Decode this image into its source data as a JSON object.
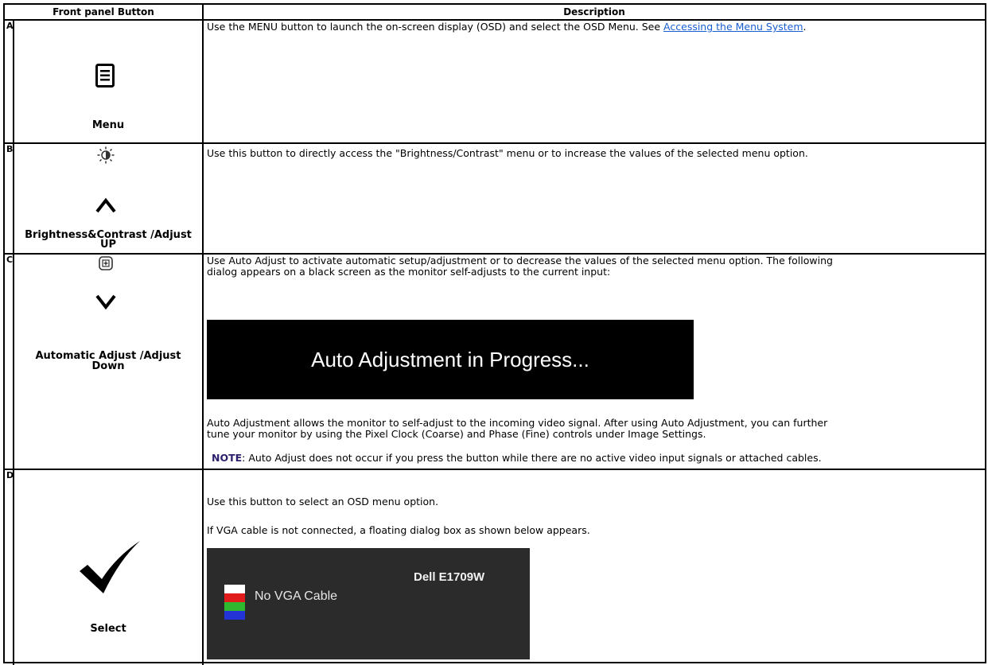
{
  "header": {
    "col1": "Front panel Button",
    "col2": "Description"
  },
  "rows": [
    {
      "letter": "A",
      "label": "Menu",
      "desc_pre": "Use the MENU button to launch the on-screen display (OSD) and select the OSD Menu. See ",
      "desc_link": "Accessing the Menu System",
      "desc_post": "."
    },
    {
      "letter": "B",
      "label_line1": "Brightness&Contrast /Adjust",
      "label_line2": "UP",
      "desc": "Use this button to directly access the \"Brightness/Contrast\" menu or to increase the values of the selected menu option."
    },
    {
      "letter": "C",
      "label_line1": "Automatic Adjust /Adjust",
      "label_line2": "Down",
      "desc_line1": "Use Auto Adjust to activate automatic setup/adjustment or to decrease the values of the selected menu option. The following",
      "desc_line2": "dialog appears on a black screen as the monitor self-adjusts to the current input:",
      "osd_text": "Auto Adjustment in Progress...",
      "desc2_line1": "Auto Adjustment allows the monitor to self-adjust to the incoming video signal. After using Auto Adjustment, you can further",
      "desc2_line2": "tune your monitor by using the Pixel Clock (Coarse) and Phase (Fine) controls under Image Settings.",
      "note_label": "NOTE",
      "note_text": ": Auto Adjust does not occur if you press the button while there are no active video input signals or attached cables."
    },
    {
      "letter": "D",
      "label": "Select",
      "desc1": "Use this button to select an OSD menu option.",
      "desc2": "If VGA cable is not connected, a floating dialog box as shown below appears.",
      "osd_message": "No VGA Cable",
      "osd_model": "Dell E1709W"
    }
  ],
  "icons": {
    "menu": "menu-icon",
    "brightness": "brightness-contrast-icon",
    "up": "chevron-up-icon",
    "auto": "auto-adjust-icon",
    "down": "chevron-down-icon",
    "select": "checkmark-icon"
  },
  "colors": {
    "link": "#1a5fd1",
    "osd_bg": "#000000",
    "osd2_bg": "#2b2b2b",
    "note": "#2a1f6b"
  }
}
